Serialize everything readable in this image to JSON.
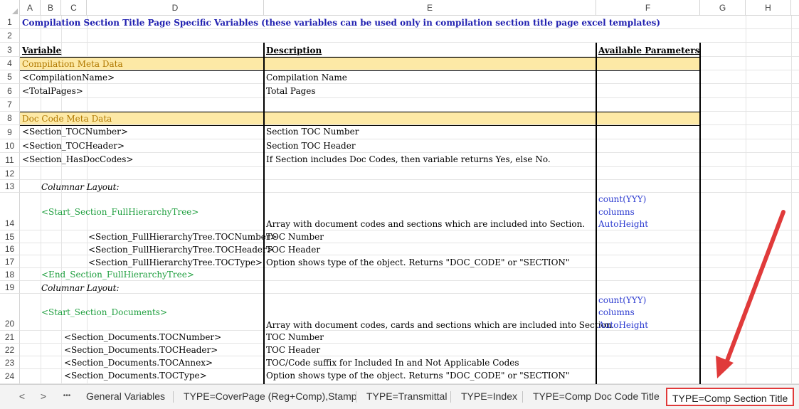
{
  "columns": [
    "A",
    "B",
    "C",
    "D",
    "E",
    "F",
    "G",
    "H"
  ],
  "rows": [
    "1",
    "2",
    "3",
    "4",
    "5",
    "6",
    "7",
    "8",
    "9",
    "10",
    "11",
    "12",
    "13",
    "14",
    "15",
    "16",
    "17",
    "18",
    "19",
    "20",
    "21",
    "22",
    "23",
    "24"
  ],
  "cells": {
    "r1": "Compilation Section Title Page Specific Variables (these variables can be used only in compilation section title page excel templates)",
    "r3_d": "Variable",
    "r3_e": "Description",
    "r3_f": "Available Parameters",
    "r4": "Compilation Meta Data",
    "r5_d": "<CompilationName>",
    "r5_e": "Compilation Name",
    "r6_d": "<TotalPages>",
    "r6_e": "Total Pages",
    "r8": "Doc Code Meta Data",
    "r9_d": "<Section_TOCNumber>",
    "r9_e": "Section TOC Number",
    "r10_d": "<Section_TOCHeader>",
    "r10_e": "Section TOC Header",
    "r11_d": "<Section_HasDocCodes>",
    "r11_e": "If Section includes Doc Codes, then variable returns Yes, else No.",
    "r13": "Columnar Layout:",
    "r14_d": "<Start_Section_FullHierarchyTree>",
    "r14_e": "Array with document codes and sections which are included into Section.",
    "r14_f1": "count(YYY)",
    "r14_f2": "columns",
    "r14_f3": "AutoHeight",
    "r15_d": "<Section_FullHierarchyTree.TOCNumber>",
    "r15_e": "TOC Number",
    "r16_d": "<Section_FullHierarchyTree.TOCHeader>",
    "r16_e": "TOC Header",
    "r17_d": "<Section_FullHierarchyTree.TOCType>",
    "r17_e": "Option shows type of the object. Returns \"DOC_CODE\" or \"SECTION\"",
    "r18_d": "<End_Section_FullHierarchyTree>",
    "r19": "Columnar Layout:",
    "r20_d": "<Start_Section_Documents>",
    "r20_e": "Array with document codes, cards and sections which are included into Section.",
    "r20_f1": "count(YYY)",
    "r20_f2": "columns",
    "r20_f3": "AutoHeight",
    "r21_d": "<Section_Documents.TOCNumber>",
    "r21_e": "TOC Number",
    "r22_d": "<Section_Documents.TOCHeader>",
    "r22_e": "TOC Header",
    "r23_d": "<Section_Documents.TOCAnnex>",
    "r23_e": "TOC/Code suffix for Included In and Not Applicable Codes",
    "r24_d": "<Section_Documents.TOCType>",
    "r24_e": "Option shows type of the object. Returns \"DOC_CODE\" or \"SECTION\""
  },
  "tabbar": {
    "prev": "<",
    "next": ">",
    "more": "•••",
    "tabs": [
      "General Variables",
      "TYPE=CoverPage (Reg+Comp),Stamp",
      "TYPE=Transmittal",
      "TYPE=Index",
      "TYPE=Comp Doc Code Title",
      "TYPE=Comp Section Title"
    ],
    "active_tab": "TYPE=Comp Section Title"
  },
  "colors": {
    "title": "#2020b0",
    "section_band": "#fde9a6",
    "section_text": "#b07800",
    "tag_green": "#1f9f3f",
    "param_blue": "#2b3ad0",
    "highlight": "#e03a3a"
  }
}
